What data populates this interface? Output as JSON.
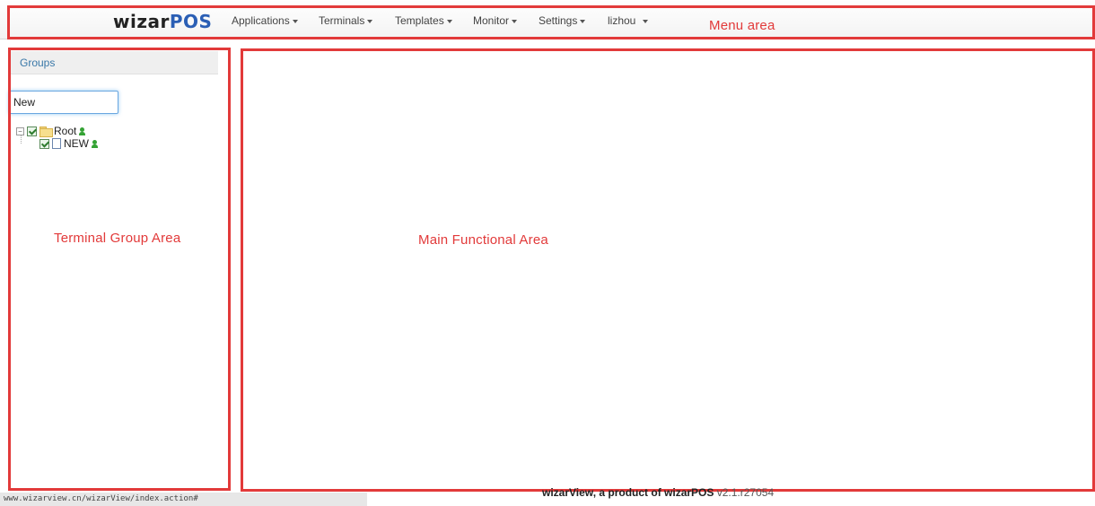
{
  "header": {
    "logo_prefix": "wizar",
    "logo_suffix": "POS",
    "menus": [
      {
        "label": "Applications"
      },
      {
        "label": "Terminals"
      },
      {
        "label": "Templates"
      },
      {
        "label": "Monitor"
      },
      {
        "label": "Settings"
      },
      {
        "label": "lizhou"
      }
    ]
  },
  "annotations": {
    "menu_area": "Menu area",
    "terminal_group_area": "Terminal Group Area",
    "main_functional_area": "Main Functional Area"
  },
  "sidebar": {
    "title": "Groups",
    "search_value": "New",
    "tree": [
      {
        "label": "Root",
        "icon": "folder-icon"
      },
      {
        "label": "NEW",
        "icon": "file-icon"
      }
    ]
  },
  "status_bar": {
    "url": "www.wizarview.cn/wizarView/index.action#"
  },
  "footer": {
    "product": "wizarView, a product of wizarPOS",
    "version": "v2.1.r27054"
  },
  "colors": {
    "annotation": "#e23a3a",
    "brand_blue": "#2b5fb5",
    "groups_title": "#3a78a8",
    "user_icon": "#35a335"
  }
}
